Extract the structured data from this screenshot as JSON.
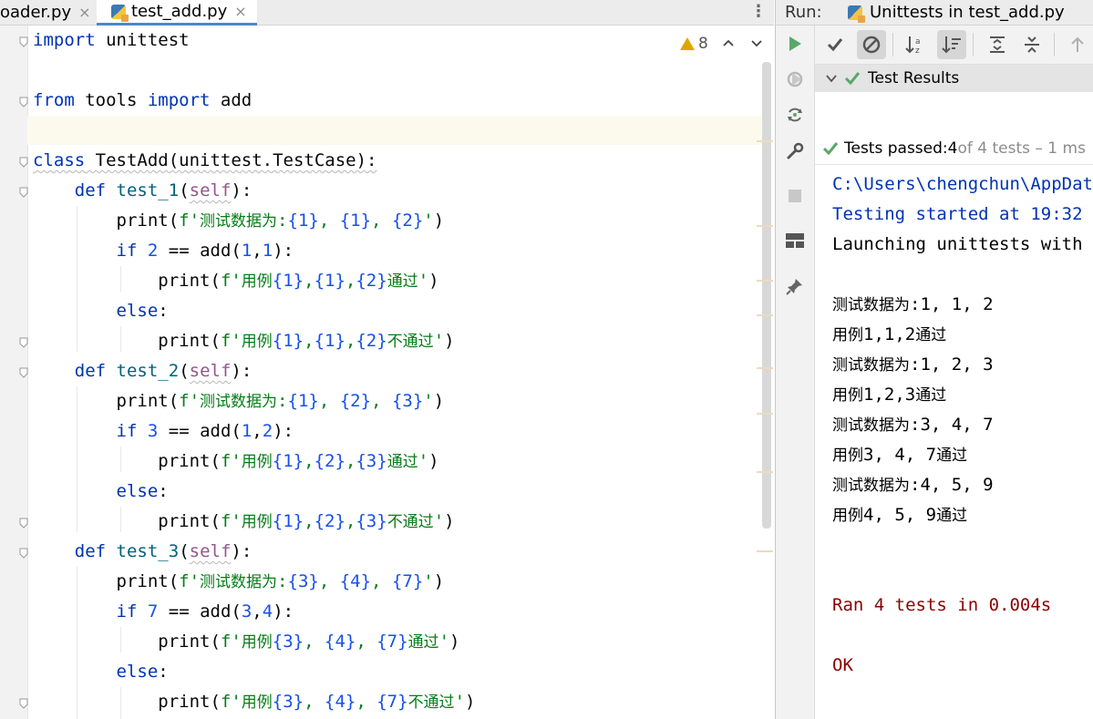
{
  "editor": {
    "tabs": [
      {
        "label": "oader.py",
        "active": false
      },
      {
        "label": "test_add.py",
        "active": true
      }
    ],
    "close_glyph": "×",
    "inspection": {
      "count": "8"
    },
    "lines": [
      "import unittest",
      "",
      "from tools import add",
      "",
      "class TestAdd(unittest.TestCase):",
      "    def test_1(self):",
      "        print(f'测试数据为:{1}, {1}, {2}')",
      "        if 2 == add(1,1):",
      "            print(f'用例{1},{1},{2}通过')",
      "        else:",
      "            print(f'用例{1},{1},{2}不通过')",
      "    def test_2(self):",
      "        print(f'测试数据为:{1}, {2}, {3}')",
      "        if 3 == add(1,2):",
      "            print(f'用例{1},{2},{3}通过')",
      "        else:",
      "            print(f'用例{1},{2},{3}不通过')",
      "    def test_3(self):",
      "        print(f'测试数据为:{3}, {4}, {7}')",
      "        if 7 == add(3,4):",
      "            print(f'用例{3}, {4}, {7}通过')",
      "        else:",
      "            print(f'用例{3}, {4}, {7}不通过')"
    ]
  },
  "run": {
    "label": "Run:",
    "tab_title": "Unittests in test_add.py",
    "tree_root": "Test Results",
    "status": {
      "prefix": "Tests passed: ",
      "passed": "4",
      "suffix": " of 4 tests – 1 ms"
    },
    "console": [
      {
        "text": "C:\\Users\\chengchun\\AppData",
        "kind": "sys"
      },
      {
        "text": "Testing started at 19:32",
        "kind": "sys"
      },
      {
        "text": "Launching unittests with",
        "kind": "out"
      },
      {
        "text": "",
        "kind": "out"
      },
      {
        "text": "测试数据为:1, 1, 2",
        "kind": "out"
      },
      {
        "text": "用例1,1,2通过",
        "kind": "out"
      },
      {
        "text": "测试数据为:1, 2, 3",
        "kind": "out"
      },
      {
        "text": "用例1,2,3通过",
        "kind": "out"
      },
      {
        "text": "测试数据为:3, 4, 7",
        "kind": "out"
      },
      {
        "text": "用例3, 4, 7通过",
        "kind": "out"
      },
      {
        "text": "测试数据为:4, 5, 9",
        "kind": "out"
      },
      {
        "text": "用例4, 5, 9通过",
        "kind": "out"
      },
      {
        "text": "",
        "kind": "out"
      },
      {
        "text": "",
        "kind": "out"
      },
      {
        "text": "Ran 4 tests in 0.004s",
        "kind": "err"
      },
      {
        "text": "",
        "kind": "out"
      },
      {
        "text": "OK",
        "kind": "err"
      }
    ]
  },
  "colors": {
    "keyword": "#0033b3",
    "string": "#067d17",
    "number": "#1750eb",
    "self": "#94558d",
    "pass_green": "#59a869",
    "stderr": "#8b0000"
  }
}
